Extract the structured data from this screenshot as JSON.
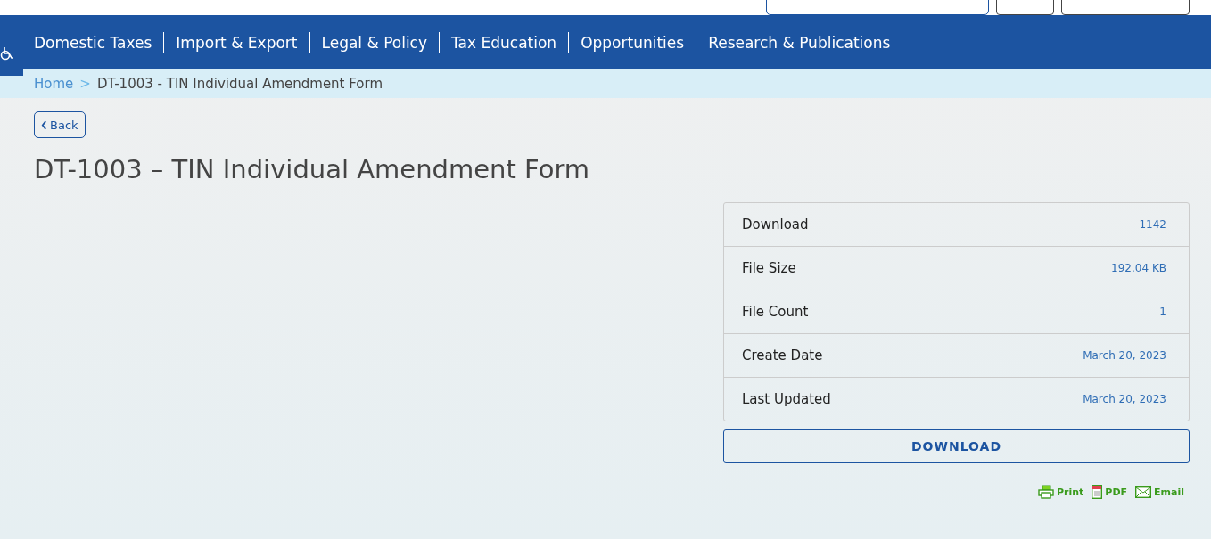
{
  "nav": {
    "items": [
      "Domestic Taxes",
      "Import & Export",
      "Legal & Policy",
      "Tax Education",
      "Opportunities",
      "Research & Publications"
    ]
  },
  "breadcrumb": {
    "home": "Home",
    "separator": ">",
    "current": "DT-1003 - TIN Individual Amendment Form"
  },
  "back": {
    "label": "Back"
  },
  "title": "DT-1003 – TIN Individual Amendment Form",
  "details": [
    {
      "label": "Download",
      "value": "1142"
    },
    {
      "label": "File Size",
      "value": "192.04 KB"
    },
    {
      "label": "File Count",
      "value": "1"
    },
    {
      "label": "Create Date",
      "value": "March 20, 2023"
    },
    {
      "label": "Last Updated",
      "value": "March 20, 2023"
    }
  ],
  "download_button": "DOWNLOAD",
  "share": [
    {
      "kind": "print",
      "label": "Print"
    },
    {
      "kind": "pdf",
      "label": "PDF"
    },
    {
      "kind": "email",
      "label": "Email"
    }
  ]
}
